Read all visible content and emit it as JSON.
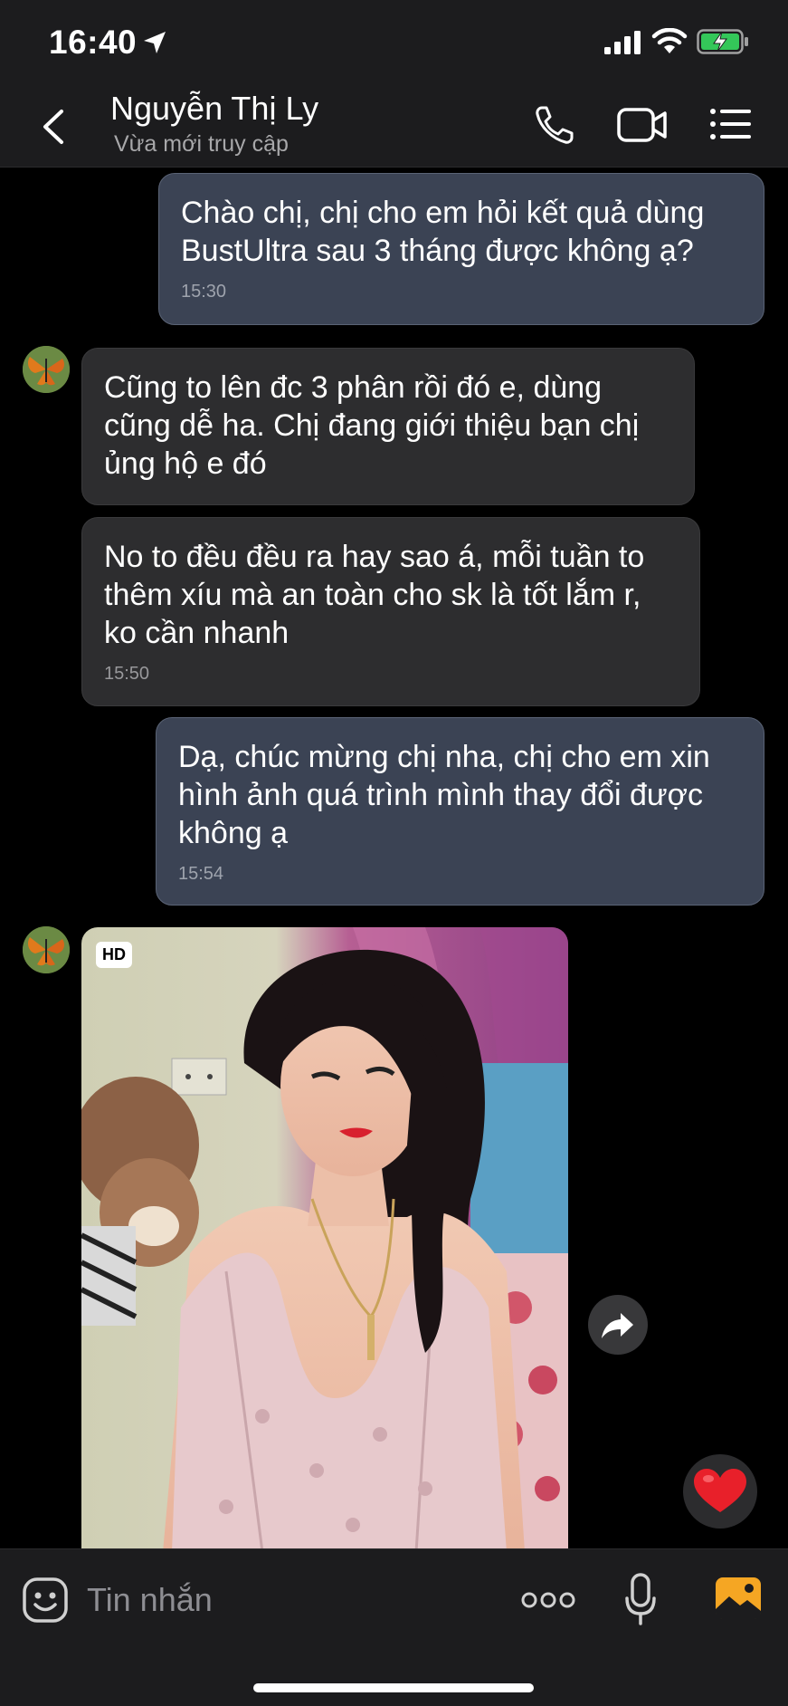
{
  "status_bar": {
    "time": "16:40"
  },
  "header": {
    "contact_name": "Nguyễn Thị Ly",
    "contact_status": "Vừa mới truy cập"
  },
  "messages": [
    {
      "direction": "out",
      "text": "Chào chị, chị cho em hỏi kết quả dùng BustUltra sau 3 tháng được không ạ?",
      "time": "15:30"
    },
    {
      "direction": "in",
      "text": "Cũng to lên đc 3 phân rồi đó e, dùng cũng dễ ha. Chị đang giới thiệu bạn chị ủng hộ e đó",
      "time": ""
    },
    {
      "direction": "in",
      "text": "No to đều đều ra hay sao á, mỗi tuần to thêm xíu mà an toàn cho sk là tốt lắm r, ko cần nhanh",
      "time": "15:50"
    },
    {
      "direction": "out",
      "text": "Dạ, chúc mừng chị nha, chị cho em xin hình ảnh quá trình mình thay đổi được không ạ",
      "time": "15:54"
    }
  ],
  "photo_message": {
    "badge": "HD"
  },
  "input_bar": {
    "placeholder": "Tin nhắn"
  },
  "colors": {
    "accent": "#f5a623",
    "heart": "#e8202a",
    "outgoing_bubble": "#3b4354",
    "incoming_bubble": "#2d2d2f"
  }
}
